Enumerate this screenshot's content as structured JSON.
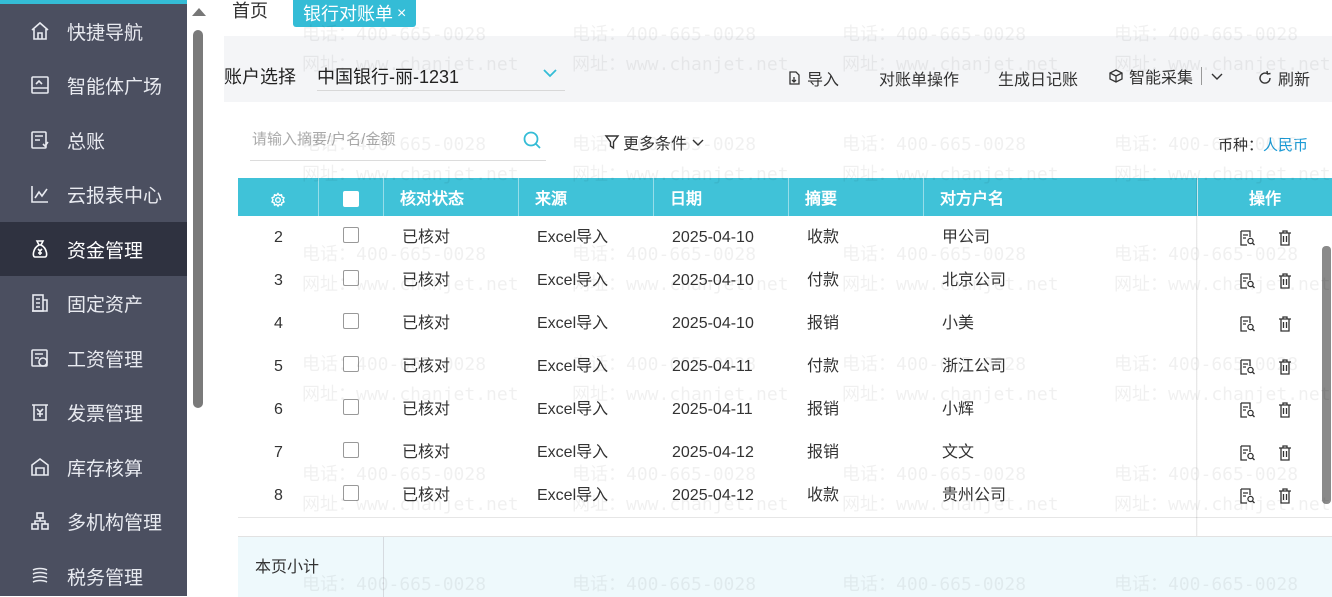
{
  "sidebar": {
    "items": [
      {
        "label": "快捷导航",
        "icon": "home-icon"
      },
      {
        "label": "智能体广场",
        "icon": "board-icon"
      },
      {
        "label": "总账",
        "icon": "ledger-icon"
      },
      {
        "label": "云报表中心",
        "icon": "chart-line-icon"
      },
      {
        "label": "资金管理",
        "icon": "money-bag-icon",
        "active": true
      },
      {
        "label": "固定资产",
        "icon": "building-icon"
      },
      {
        "label": "工资管理",
        "icon": "salary-icon"
      },
      {
        "label": "发票管理",
        "icon": "invoice-icon"
      },
      {
        "label": "库存核算",
        "icon": "warehouse-icon"
      },
      {
        "label": "多机构管理",
        "icon": "org-icon"
      },
      {
        "label": "税务管理",
        "icon": "tax-icon"
      }
    ]
  },
  "tabs": {
    "home": "首页",
    "active": "银行对账单",
    "close": "×"
  },
  "toolbar": {
    "account_label": "账户选择",
    "account_value": "中国银行-丽-1231",
    "import": "导入",
    "reconcile_ops": "对账单操作",
    "gen_journal": "生成日记账",
    "smart_collect": "智能采集",
    "refresh": "刷新"
  },
  "filter": {
    "search_placeholder": "请输入摘要/户名/金额",
    "more": "更多条件",
    "currency_label": "币种：",
    "currency_value": "人民币"
  },
  "table": {
    "headers": {
      "status": "核对状态",
      "source": "来源",
      "date": "日期",
      "summary": "摘要",
      "counterparty": "对方户名",
      "ops": "操作"
    },
    "rows": [
      {
        "no": "2",
        "status": "已核对",
        "source": "Excel导入",
        "date": "2025-04-10",
        "summary": "收款",
        "counterparty": "甲公司"
      },
      {
        "no": "3",
        "status": "已核对",
        "source": "Excel导入",
        "date": "2025-04-10",
        "summary": "付款",
        "counterparty": "北京公司"
      },
      {
        "no": "4",
        "status": "已核对",
        "source": "Excel导入",
        "date": "2025-04-10",
        "summary": "报销",
        "counterparty": "小美"
      },
      {
        "no": "5",
        "status": "已核对",
        "source": "Excel导入",
        "date": "2025-04-11",
        "summary": "付款",
        "counterparty": "浙江公司"
      },
      {
        "no": "6",
        "status": "已核对",
        "source": "Excel导入",
        "date": "2025-04-11",
        "summary": "报销",
        "counterparty": "小辉"
      },
      {
        "no": "7",
        "status": "已核对",
        "source": "Excel导入",
        "date": "2025-04-12",
        "summary": "报销",
        "counterparty": "文文"
      },
      {
        "no": "8",
        "status": "已核对",
        "source": "Excel导入",
        "date": "2025-04-12",
        "summary": "收款",
        "counterparty": "贵州公司"
      }
    ],
    "subtotal_label": "本页小计"
  },
  "watermark": {
    "phone": "电话：400-665-0028",
    "site": "网址：www.chanjet.net"
  },
  "colors": {
    "accent": "#34bcd6",
    "header": "#40c2d8",
    "sidebar": "#4b4f60",
    "sidebar_active": "#2f3240",
    "currency": "#1c9bd6"
  }
}
